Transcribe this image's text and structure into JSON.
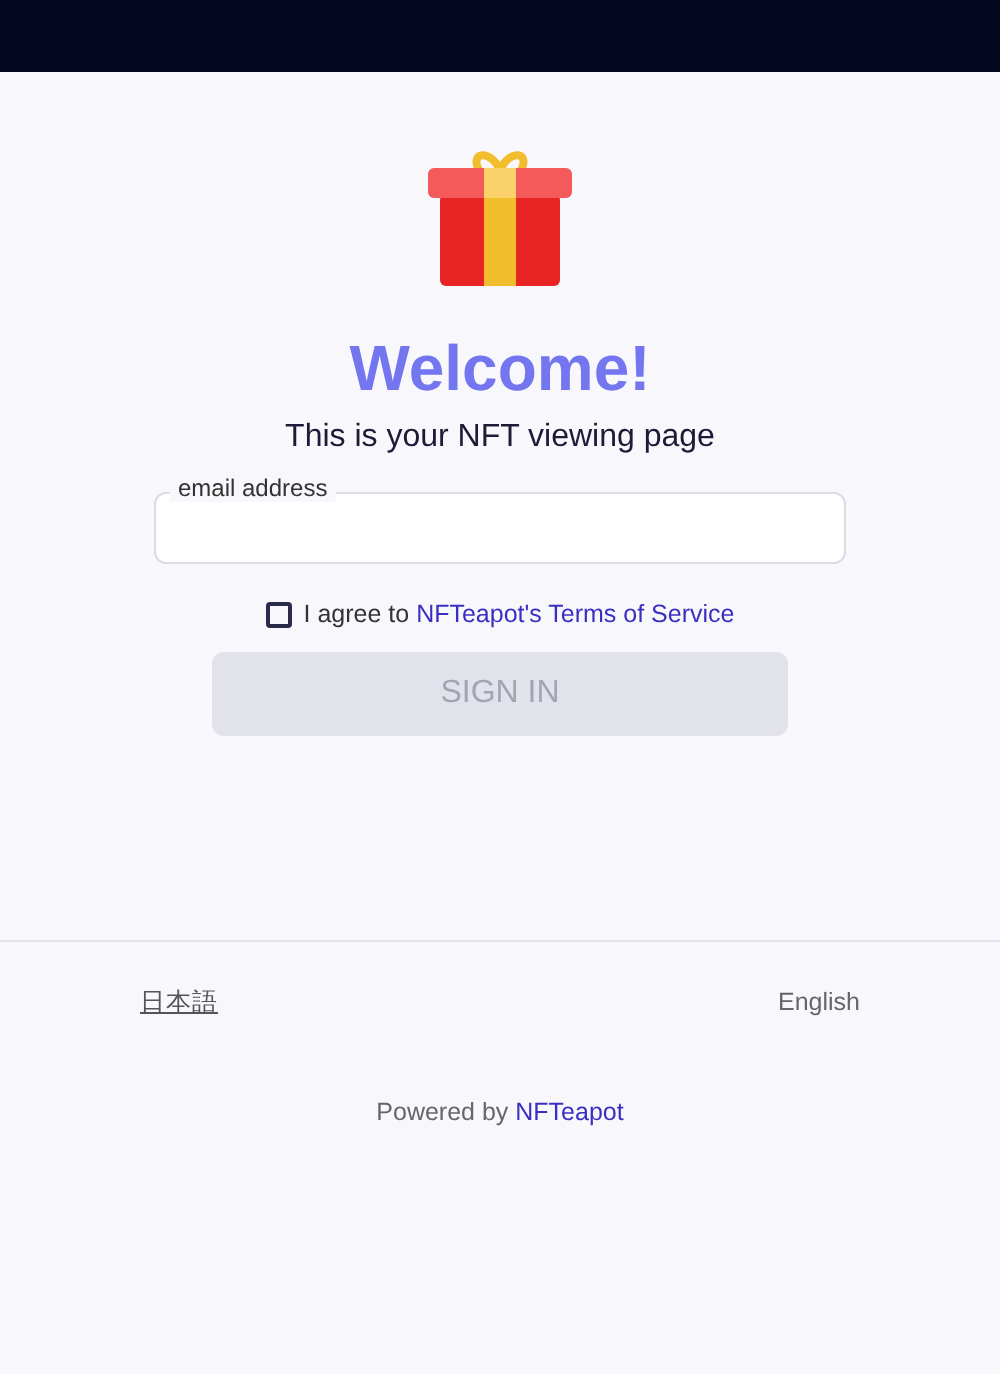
{
  "title": "Welcome!",
  "subtitle": "This is your NFT viewing page",
  "email_field": {
    "label": "email address"
  },
  "terms": {
    "checked": false,
    "text": "I agree to ",
    "link": "NFTeapot's Terms of Service"
  },
  "sign_in_button": {
    "label": "SIGN IN",
    "disabled": true
  },
  "languages": [
    {
      "label": "日本語",
      "selected": false
    },
    {
      "label": "English",
      "selected": true
    }
  ],
  "footer": {
    "text": "Powered by ",
    "link": "NFTeapot"
  }
}
